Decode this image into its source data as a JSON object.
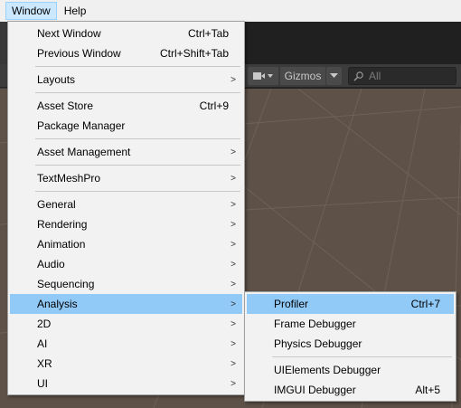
{
  "menubar": {
    "items": [
      "Window",
      "Help"
    ]
  },
  "scene_toolbar": {
    "gizmos_label": "Gizmos",
    "search_placeholder": "All"
  },
  "window_menu": {
    "items": [
      {
        "label": "Next Window",
        "shortcut": "Ctrl+Tab"
      },
      {
        "label": "Previous Window",
        "shortcut": "Ctrl+Shift+Tab"
      },
      {
        "label": "Layouts",
        "submenu": true
      },
      {
        "label": "Asset Store",
        "shortcut": "Ctrl+9"
      },
      {
        "label": "Package Manager"
      },
      {
        "label": "Asset Management",
        "submenu": true
      },
      {
        "label": "TextMeshPro",
        "submenu": true
      },
      {
        "label": "General",
        "submenu": true
      },
      {
        "label": "Rendering",
        "submenu": true
      },
      {
        "label": "Animation",
        "submenu": true
      },
      {
        "label": "Audio",
        "submenu": true
      },
      {
        "label": "Sequencing",
        "submenu": true
      },
      {
        "label": "Analysis",
        "submenu": true,
        "highlighted": true
      },
      {
        "label": "2D",
        "submenu": true
      },
      {
        "label": "AI",
        "submenu": true
      },
      {
        "label": "XR",
        "submenu": true
      },
      {
        "label": "UI",
        "submenu": true
      }
    ]
  },
  "analysis_submenu": {
    "items": [
      {
        "label": "Profiler",
        "shortcut": "Ctrl+7",
        "highlighted": true
      },
      {
        "label": "Frame Debugger"
      },
      {
        "label": "Physics Debugger"
      },
      {
        "label": "UIElements Debugger"
      },
      {
        "label": "IMGUI Debugger",
        "shortcut": "Alt+5"
      }
    ]
  },
  "colors": {
    "highlight": "#91c9f7",
    "menu_bg": "#f2f2f2",
    "scene_bg": "#5d5148"
  }
}
